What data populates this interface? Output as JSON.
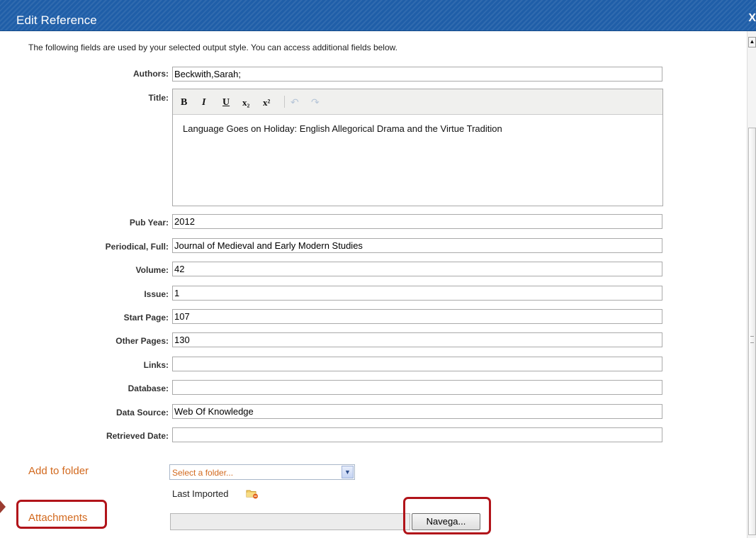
{
  "window": {
    "title": "Edit Reference",
    "close_glyph": "X"
  },
  "intro_text": "The following fields are used by your selected output style. You can access additional fields below.",
  "fields": {
    "authors": {
      "label": "Authors:",
      "value": "Beckwith,Sarah;"
    },
    "title": {
      "label": "Title:",
      "value": "Language Goes on Holiday: English Allegorical Drama and the Virtue Tradition"
    },
    "pub_year": {
      "label": "Pub Year:",
      "value": "2012"
    },
    "periodical": {
      "label": "Periodical, Full:",
      "value": "Journal of Medieval and Early Modern Studies"
    },
    "volume": {
      "label": "Volume:",
      "value": "42"
    },
    "issue": {
      "label": "Issue:",
      "value": "1"
    },
    "start_page": {
      "label": "Start Page:",
      "value": "107"
    },
    "other_pages": {
      "label": "Other Pages:",
      "value": "130"
    },
    "links": {
      "label": "Links:",
      "value": ""
    },
    "database": {
      "label": "Database:",
      "value": ""
    },
    "data_source": {
      "label": "Data Source:",
      "value": "Web Of Knowledge"
    },
    "retrieved_date": {
      "label": "Retrieved Date:",
      "value": ""
    }
  },
  "editor_toolbar": {
    "bold": "B",
    "italic": "I",
    "underline": "U",
    "subscript": "x₂",
    "superscript": "x²",
    "undo": "↶",
    "redo": "↷"
  },
  "add_to_folder": {
    "label": "Add to folder",
    "select_value": "Select a folder...",
    "last_imported": "Last Imported"
  },
  "attachments": {
    "label": "Attachments",
    "browse_button": "Navega..."
  },
  "icons": {
    "folder": "folder-add-icon",
    "dropdown": "chevron-down-icon",
    "scroll_up": "scroll-up-icon"
  },
  "colors": {
    "title_bar": "#1f5ea8",
    "section_label": "#d2691e",
    "highlight": "#b1141a"
  }
}
